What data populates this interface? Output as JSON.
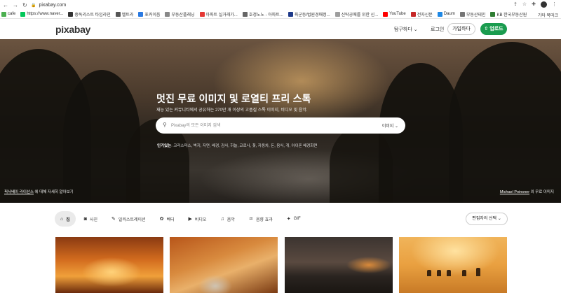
{
  "browser": {
    "url": "pixabay.com",
    "bookmarks": [
      {
        "label": "cafe",
        "color": "#4caf50"
      },
      {
        "label": "https://www.naver...",
        "color": "#03c75a"
      },
      {
        "label": "중독리스트 타임라인",
        "color": "#333333"
      },
      {
        "label": "멜트라",
        "color": "#555555"
      },
      {
        "label": "포커이음",
        "color": "#2a7ae2"
      },
      {
        "label": "부동산플래닝",
        "color": "#888888"
      },
      {
        "label": "아파트 실거래가...",
        "color": "#e53935"
      },
      {
        "label": "호갱노노 - 아파트...",
        "color": "#666666"
      },
      {
        "label": "육군등/법원경매정...",
        "color": "#1e3a8a"
      },
      {
        "label": "신탁공매를 위한 신...",
        "color": "#9e9e9e"
      },
      {
        "label": "YouTube",
        "color": "#ff0000"
      },
      {
        "label": "전자신문",
        "color": "#c62828"
      },
      {
        "label": "Daum",
        "color": "#1e88e5"
      },
      {
        "label": "부동산테인",
        "color": "#757575"
      },
      {
        "label": "KB 한국부동산원",
        "color": "#2e7d32"
      }
    ],
    "other_bookmarks": "기타 북마크"
  },
  "header": {
    "logo": "pixabay",
    "explore": "탐구하다",
    "login": "로그인",
    "join": "가입하다",
    "upload": "업로드"
  },
  "hero": {
    "title": "멋진 무료 이미지 및 로열티 프리 스톡",
    "subtitle": "재능 있는 커뮤니티에서 공유하는 270만 개 이상의 고품질 스톡 이미지, 비디오 및 음악.",
    "search_placeholder": "Pixabay의 모든 이미지 검색",
    "search_type": "이미지",
    "popular_label": "인기있는",
    "popular_terms": ": 크리스마스, 벽지, 자연, 배경, 감사, 하늘, 코로나, 꽃, 자동차, 돈, 음식, 개, 아이폰 배경화면",
    "license_link": "픽사베이 라이선스",
    "license_text": " 에 대해 자세히 알아보기",
    "credit_name": "Michael Poinsner",
    "credit_text": " 의 무료 이미지"
  },
  "tabs": [
    {
      "label": "집",
      "icon": "⌂",
      "active": true
    },
    {
      "label": "사진",
      "icon": "◙",
      "active": false
    },
    {
      "label": "일러스트레이션",
      "icon": "✎",
      "active": false
    },
    {
      "label": "벡터",
      "icon": "✿",
      "active": false
    },
    {
      "label": "비디오",
      "icon": "▶",
      "active": false
    },
    {
      "label": "음악",
      "icon": "♫",
      "active": false
    },
    {
      "label": "음향 효과",
      "icon": "♒",
      "active": false
    },
    {
      "label": "GIF",
      "icon": "✦",
      "active": false
    }
  ],
  "editors_choice": "편집자의 선택"
}
